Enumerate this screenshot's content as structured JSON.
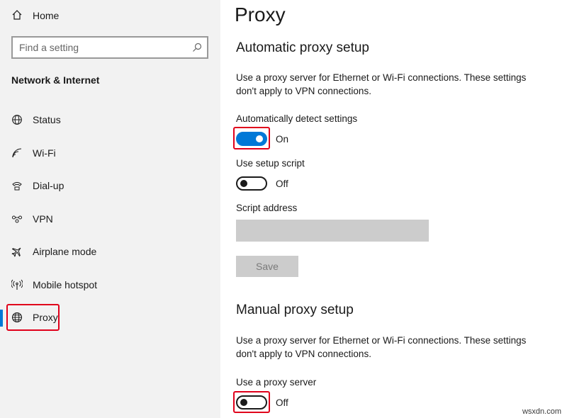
{
  "sidebar": {
    "home_label": "Home",
    "search_placeholder": "Find a setting",
    "section_title": "Network & Internet",
    "items": [
      {
        "label": "Status",
        "icon": "globe-status-icon"
      },
      {
        "label": "Wi-Fi",
        "icon": "wifi-icon"
      },
      {
        "label": "Dial-up",
        "icon": "dialup-icon"
      },
      {
        "label": "VPN",
        "icon": "vpn-icon"
      },
      {
        "label": "Airplane mode",
        "icon": "airplane-icon"
      },
      {
        "label": "Mobile hotspot",
        "icon": "hotspot-icon"
      },
      {
        "label": "Proxy",
        "icon": "globe-icon"
      }
    ],
    "selected": "Proxy"
  },
  "main": {
    "title": "Proxy",
    "auto": {
      "heading": "Automatic proxy setup",
      "description": "Use a proxy server for Ethernet or Wi-Fi connections. These settings don't apply to VPN connections.",
      "detect_label": "Automatically detect settings",
      "detect_state": "On",
      "script_label": "Use setup script",
      "script_state": "Off",
      "address_label": "Script address",
      "address_value": "",
      "save_label": "Save"
    },
    "manual": {
      "heading": "Manual proxy setup",
      "description": "Use a proxy server for Ethernet or Wi-Fi connections. These settings don't apply to VPN connections.",
      "proxy_label": "Use a proxy server",
      "proxy_state": "Off"
    }
  },
  "watermark": "wsxdn.com",
  "colors": {
    "accent": "#0078d7",
    "highlight": "#e0001b",
    "sidebar_bg": "#f2f2f2"
  }
}
